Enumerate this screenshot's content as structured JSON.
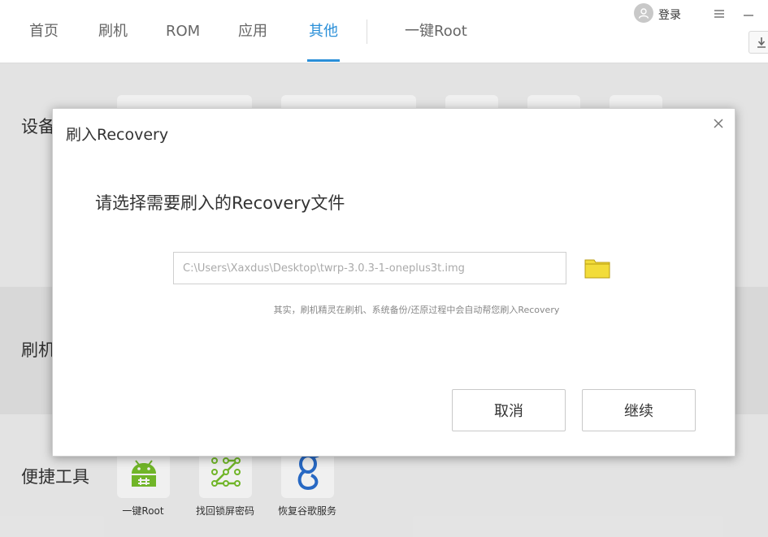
{
  "nav": {
    "items": [
      "首页",
      "刷机",
      "ROM",
      "应用",
      "其他"
    ],
    "active_index": 4,
    "root_item": "一键Root"
  },
  "header": {
    "login_label": "登录",
    "menu_icon": "hamburger-icon",
    "minimize_icon": "minimize-icon",
    "download_icon": "download-icon"
  },
  "sections": {
    "device_label": "设备",
    "flash_label": "刷机",
    "tools_label": "便捷工具"
  },
  "tools": [
    {
      "label": "一键Root",
      "icon": "android-root-icon"
    },
    {
      "label": "找回锁屏密码",
      "icon": "pattern-lock-icon"
    },
    {
      "label": "恢复谷歌服务",
      "icon": "google-g-icon"
    }
  ],
  "dialog": {
    "title": "刷入Recovery",
    "close_icon": "close-icon",
    "heading": "请选择需要刷入的Recovery文件",
    "path_value": "C:\\Users\\Xaxdus\\Desktop\\twrp-3.0.3-1-oneplus3t.img",
    "folder_icon": "folder-icon",
    "hint": "其实，刷机精灵在刷机、系统备份/还原过程中会自动帮您刷入Recovery",
    "cancel_label": "取消",
    "continue_label": "继续"
  },
  "colors": {
    "accent": "#2a8fd8",
    "folder": "#f2dc3a",
    "android_green": "#78c12b"
  }
}
